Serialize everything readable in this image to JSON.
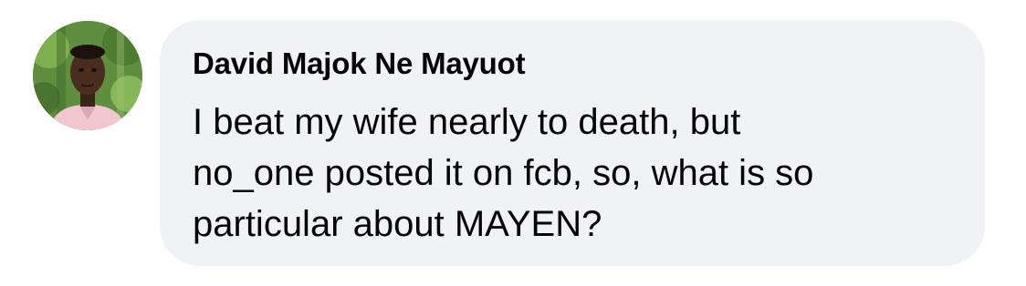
{
  "comment": {
    "author": "David Majok Ne Mayuot",
    "text_lines": [
      "I beat my wife nearly to death, but",
      "no_one posted it on fcb, so, what is so",
      "particular about MAYEN?"
    ],
    "avatar_icon": "profile-photo",
    "bubble_color": "#f0f2f5",
    "text_color": "#050505"
  }
}
